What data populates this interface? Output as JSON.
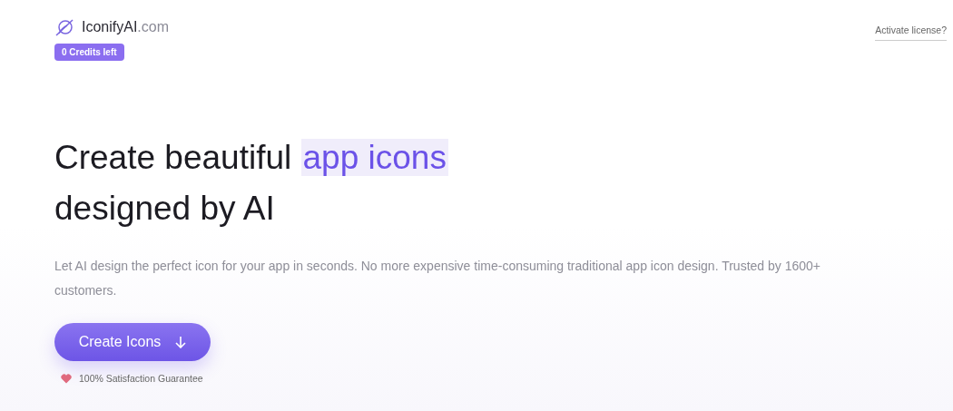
{
  "logo": {
    "name": "IconifyAI",
    "suffix": ".com"
  },
  "credits_badge": "0 Credits left",
  "activate_link": "Activate license?",
  "headline": {
    "before": "Create beautiful ",
    "highlight": "app icons",
    "line2": "designed by AI"
  },
  "description": "Let AI design the perfect icon for your app in seconds. No more expensive time-consuming traditional app icon design. Trusted by 1600+ customers.",
  "cta_button": "Create Icons",
  "guarantee": "100% Satisfaction Guarantee"
}
